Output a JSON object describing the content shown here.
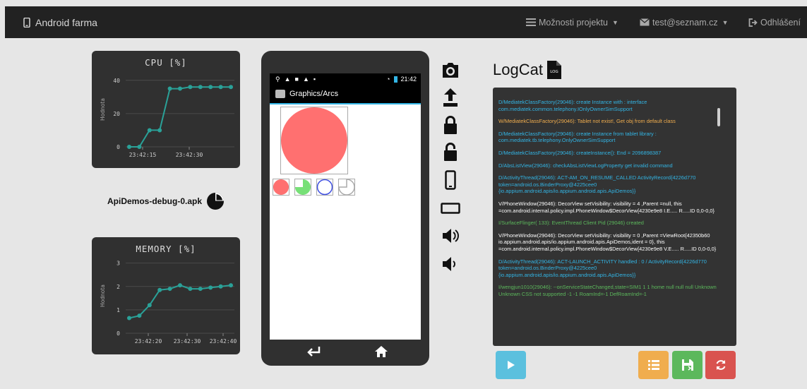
{
  "navbar": {
    "brand": "Android farma",
    "options_label": "Možnosti projektu",
    "user_email": "test@seznam.cz",
    "logout_label": "Odhlášení"
  },
  "cpu_chart": {
    "chart_data": {
      "type": "line",
      "title": "CPU [%]",
      "ylabel": "Hodnota",
      "ylim": [
        0,
        45
      ],
      "yticks": [
        0,
        20,
        40
      ],
      "xticks": [
        "23:42:15",
        "23:42:30"
      ],
      "values": [
        0,
        0,
        10,
        10,
        35,
        35,
        36,
        36,
        36,
        36,
        36
      ]
    }
  },
  "apk_name": "ApiDemos-debug-0.apk",
  "memory_chart": {
    "chart_data": {
      "type": "line",
      "title": "MEMORY [%]",
      "ylabel": "Hodnota",
      "ylim": [
        0,
        3.2
      ],
      "yticks": [
        0,
        1,
        2,
        3
      ],
      "xticks": [
        "23:42:20",
        "23:42:30",
        "23:42:40"
      ],
      "values": [
        0.65,
        0.75,
        1.2,
        1.85,
        1.9,
        2.05,
        1.9,
        1.9,
        1.95,
        2.0,
        2.05
      ]
    }
  },
  "phone": {
    "status_time": "21:42",
    "app_title": "Graphics/Arcs"
  },
  "logcat": {
    "title": "LogCat",
    "file_icon_text": "LOG",
    "lines": [
      {
        "text": "D/MediatekClassFactory(29046): create Instance with : interface com.mediatek.common.telephony.IOnlyOwnerSimSupport",
        "color": "#33b5e5"
      },
      {
        "text": "W/MediatekClassFactory(29046): Tablet not exist!, Get obj from default class",
        "color": "#f0ad4e"
      },
      {
        "text": "D/MediatekClassFactory(29046): create Instance from tablet library : com.mediatek.tb.telephony.OnlyOwnerSimSupport",
        "color": "#33b5e5"
      },
      {
        "text": "D/MediatekClassFactory(29046): createInstance(): End = 2096898387",
        "color": "#33b5e5"
      },
      {
        "text": "D/AbsListView(29046): checkAbsListViewLogProperty get invalid command",
        "color": "#33b5e5"
      },
      {
        "text": "D/ActivityThread(29046): ACT-AM_ON_RESUME_CALLED ActivityRecord{4226d770 token=android.os.BinderProxy@4225cee0 {io.appium.android.apis/io.appium.android.apis.ApiDemos}}",
        "color": "#33b5e5"
      },
      {
        "text": "V/PhoneWindow(29046): DecorView setVisibility: visibility = 4 ,Parent =null, this =com.android.internal.policy.impl.PhoneWindow$DecorView{4230e9e8 I.E..... R.....ID 0,0-0,0}",
        "color": "#ffffff"
      },
      {
        "text": "I/SurfaceFlinger( 133): EventThread Client Pid (29046) created",
        "color": "#5cb85c"
      },
      {
        "text": "V/PhoneWindow(29046): DecorView setVisibility: visibility = 0 ,Parent =ViewRoot{42350b60 io.appium.android.apis/io.appium.android.apis.ApiDemos,ident = 0}, this =com.android.internal.policy.impl.PhoneWindow$DecorView{4230e9e8 V.E..... R.....ID 0,0-0,0}",
        "color": "#ffffff"
      },
      {
        "text": "D/ActivityThread(29046): ACT-LAUNCH_ACTIVITY handled : 0 / ActivityRecord{4226d770 token=android.os.BinderProxy@4225cee0 {io.appium.android.apis/io.appium.android.apis.ApiDemos}}",
        "color": "#33b5e5"
      },
      {
        "text": "I/wengjun1010(29046): --onServiceStateChanged,state=SIM1 1 1 home null null null Unknown Unknown CSS not supported -1 -1 RoamInd=-1 DefRoamInd=-1",
        "color": "#5cb85c"
      }
    ]
  },
  "colors": {
    "line": "#2aa198",
    "panel": "#303030",
    "play_button": "#5bc0de",
    "list_button": "#f0ad4e",
    "save_button": "#5cb85c",
    "refresh_button": "#d9534f",
    "arc_fill": "#ff7070"
  }
}
